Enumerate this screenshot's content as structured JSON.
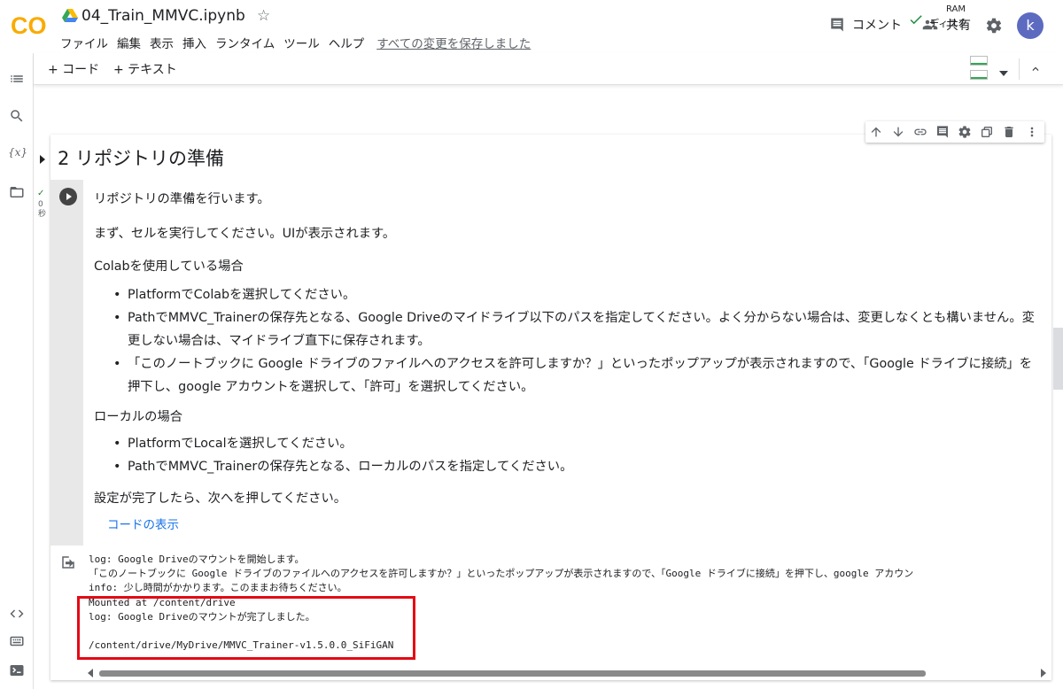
{
  "header": {
    "logo_text": "CO",
    "title": "04_Train_MMVC.ipynb",
    "menu": [
      "ファイル",
      "編集",
      "表示",
      "挿入",
      "ランタイム",
      "ツール",
      "ヘルプ"
    ],
    "saved_status": "すべての変更を保存しました",
    "comment_label": "コメント",
    "share_label": "共有",
    "avatar_letter": "k"
  },
  "toolbar": {
    "add_code": "+ コード",
    "add_text": "+ テキスト",
    "ram_label": "RAM",
    "disk_label": "ディスク"
  },
  "cell": {
    "section_title": "2 リポジトリの準備",
    "exec_check": "✓",
    "exec_time": "0",
    "exec_unit": "秒",
    "intro": "リポジトリの準備を行います。",
    "step1": "まず、セルを実行してください。UIが表示されます。",
    "colab_heading": "Colabを使用している場合",
    "colab_items": [
      "PlatformでColabを選択してください。",
      "PathでMMVC_Trainerの保存先となる、Google Driveのマイドライブ以下のパスを指定してください。よく分からない場合は、変更しなくとも構いません。変更しない場合は、マイドライブ直下に保存されます。",
      "「このノートブックに Google ドライブのファイルへのアクセスを許可しますか？」といったポップアップが表示されますので、「Google ドライブに接続」を押下し、google アカウントを選択して、「許可」を選択してください。"
    ],
    "local_heading": "ローカルの場合",
    "local_items": [
      "PlatformでLocalを選択してください。",
      "PathでMMVC_Trainerの保存先となる、ローカルのパスを指定してください。"
    ],
    "outro": "設定が完了したら、次へを押してください。",
    "show_code": "コードの表示"
  },
  "output": {
    "lines": [
      "log: Google Driveのマウントを開始します。",
      "「このノートブックに Google ドライブのファイルへのアクセスを許可しますか？」といったポップアップが表示されますので、「Google ドライブに接続」を押下し、google アカウン",
      "info: 少し時間がかかります。このままお待ちください。",
      "Mounted at /content/drive",
      "log: Google Driveのマウントが完了しました。",
      "",
      "/content/drive/MyDrive/MMVC_Trainer-v1.5.0.0_SiFiGAN"
    ]
  },
  "colors": {
    "logo_orange": "#f9ab00",
    "highlight_red": "#e50914",
    "link_blue": "#1a73e8",
    "avatar_purple": "#5c6bc0"
  }
}
